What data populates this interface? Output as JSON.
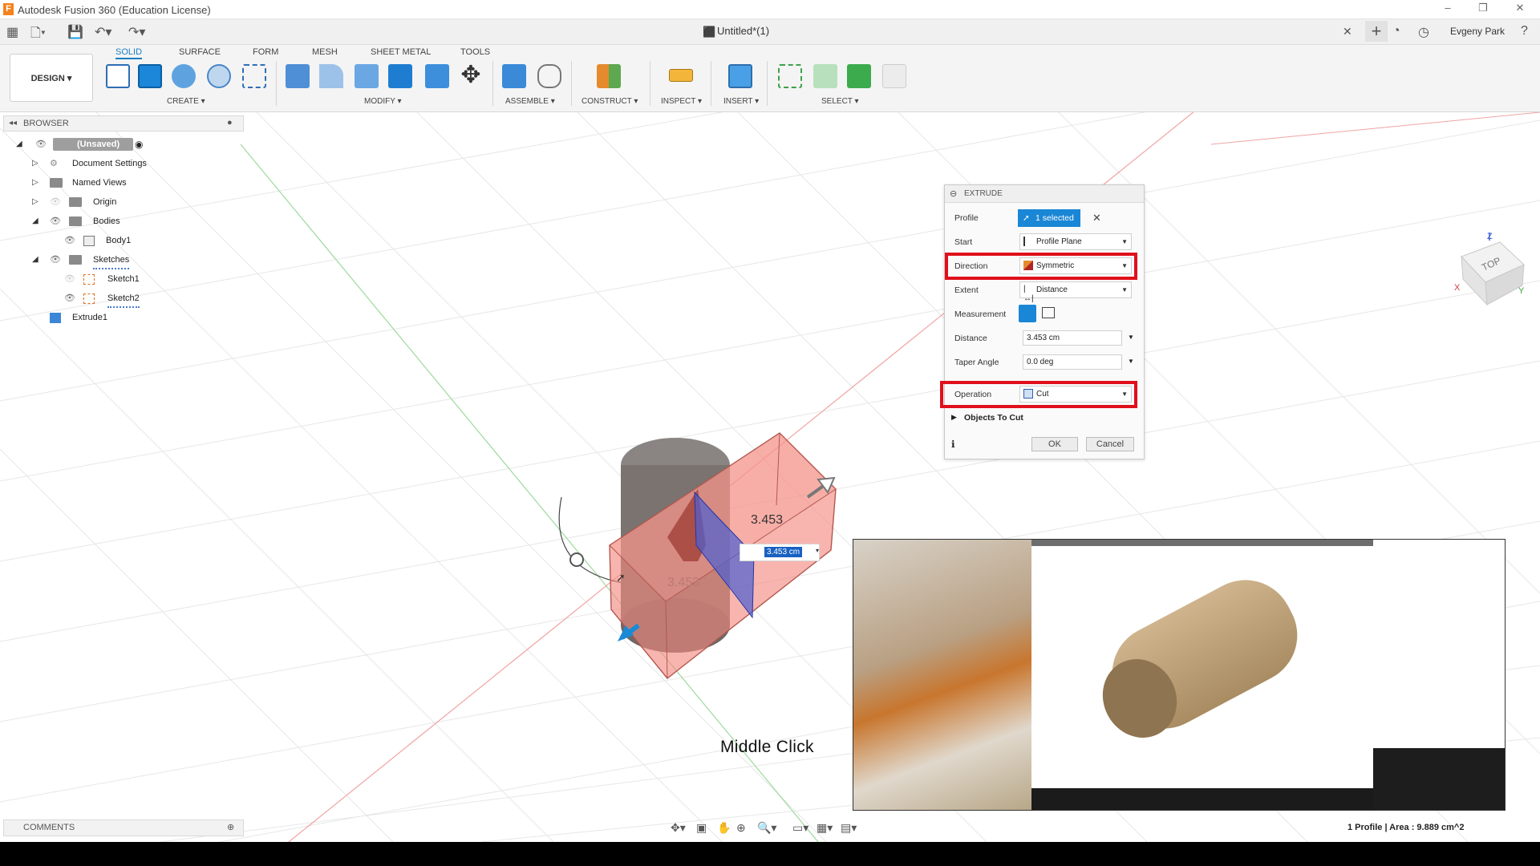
{
  "window": {
    "title": "Autodesk Fusion 360 (Education License)",
    "logo": "F"
  },
  "quickbar": {
    "document_tab": "Untitled*(1)",
    "user": "Evgeny Park"
  },
  "ribbon": {
    "workspace": "DESIGN",
    "tabs": [
      {
        "label": "SOLID",
        "active": true
      },
      {
        "label": "SURFACE"
      },
      {
        "label": "FORM"
      },
      {
        "label": "MESH"
      },
      {
        "label": "SHEET METAL"
      },
      {
        "label": "TOOLS"
      }
    ],
    "groups": [
      "CREATE",
      "MODIFY",
      "ASSEMBLE",
      "CONSTRUCT",
      "INSPECT",
      "INSERT",
      "SELECT"
    ]
  },
  "browser": {
    "header": "BROWSER",
    "items": [
      {
        "label": "(Unsaved)"
      },
      {
        "label": "Document Settings"
      },
      {
        "label": "Named Views"
      },
      {
        "label": "Origin"
      },
      {
        "label": "Bodies"
      },
      {
        "label": "Body1"
      },
      {
        "label": "Sketches"
      },
      {
        "label": "Sketch1"
      },
      {
        "label": "Sketch2"
      },
      {
        "label": "Extrude1"
      }
    ]
  },
  "extrude": {
    "title": "EXTRUDE",
    "profile_label": "Profile",
    "profile_value": "1 selected",
    "start_label": "Start",
    "start_value": "Profile Plane",
    "direction_label": "Direction",
    "direction_value": "Symmetric",
    "extent_label": "Extent",
    "extent_value": "Distance",
    "measurement_label": "Measurement",
    "distance_label": "Distance",
    "distance_value": "3.453 cm",
    "taper_label": "Taper Angle",
    "taper_value": "0.0 deg",
    "operation_label": "Operation",
    "operation_value": "Cut",
    "objects_label": "Objects To Cut",
    "ok": "OK",
    "cancel": "Cancel",
    "highlight_color": "#e0101b"
  },
  "viewport": {
    "dimension_labels": [
      "3.453",
      "3.453"
    ],
    "distance_input": "3.453 cm",
    "viewcube_face": "TOP",
    "axis_labels": [
      "Z",
      "X",
      "Y"
    ],
    "body_color": "#f4877e",
    "plane_color": "#4b5fd1"
  },
  "comments": {
    "label": "COMMENTS"
  },
  "status": {
    "text": "1 Profile | Area : 9.889 cm^2"
  },
  "overlay": {
    "caption": "Middle Click"
  }
}
